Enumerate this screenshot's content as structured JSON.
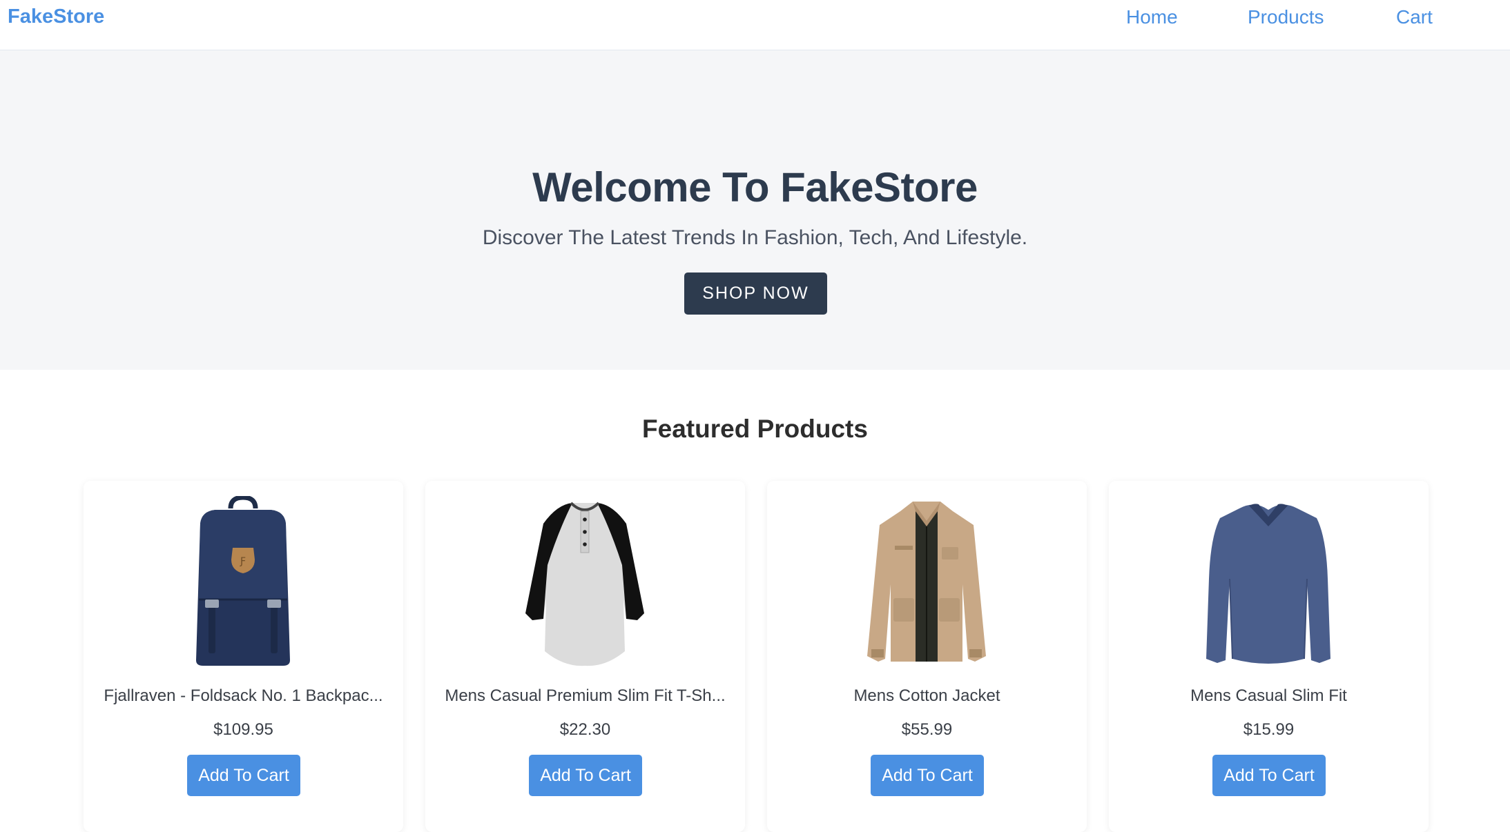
{
  "nav": {
    "brand": "FakeStore",
    "links": [
      "Home",
      "Products",
      "Cart"
    ]
  },
  "hero": {
    "title": "Welcome To FakeStore",
    "subtitle": "Discover The Latest Trends In Fashion, Tech, And Lifestyle.",
    "button": "SHOP NOW"
  },
  "featured": {
    "title": "Featured Products",
    "products": [
      {
        "title": "Fjallraven - Foldsack No. 1 Backpac...",
        "price": "$109.95",
        "button": "Add To Cart",
        "image": "backpack-image"
      },
      {
        "title": "Mens Casual Premium Slim Fit T-Sh...",
        "price": "$22.30",
        "button": "Add To Cart",
        "image": "raglan-shirt-image"
      },
      {
        "title": "Mens Cotton Jacket",
        "price": "$55.99",
        "button": "Add To Cart",
        "image": "cotton-jacket-image"
      },
      {
        "title": "Mens Casual Slim Fit",
        "price": "$15.99",
        "button": "Add To Cart",
        "image": "long-sleeve-shirt-image"
      }
    ]
  },
  "colors": {
    "accent": "#4a90e2",
    "dark": "#2d3b4e",
    "hero_bg": "#f5f6f8"
  }
}
